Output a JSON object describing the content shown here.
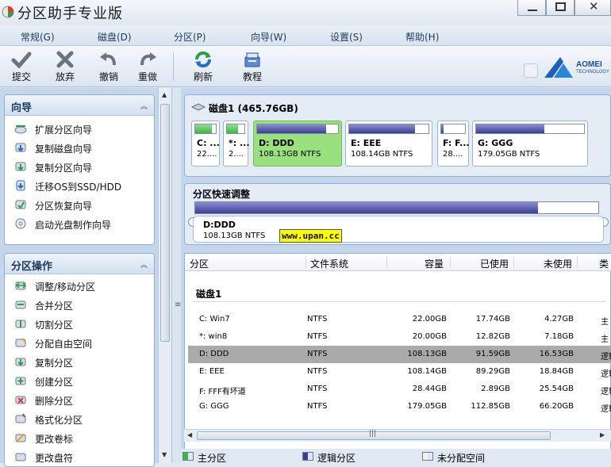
{
  "titlebar": {
    "title": "分区助手专业版"
  },
  "menu": [
    "常规(G)",
    "磁盘(D)",
    "分区(P)",
    "向导(W)",
    "设置(S)",
    "帮助(H)"
  ],
  "toolbar": {
    "buttons": [
      {
        "label": "提交",
        "icon": "check-icon"
      },
      {
        "label": "放弃",
        "icon": "discard-icon"
      },
      {
        "label": "撤销",
        "icon": "undo-icon"
      },
      {
        "label": "重做",
        "icon": "redo-icon"
      },
      {
        "label": "刷新",
        "icon": "refresh-icon"
      },
      {
        "label": "教程",
        "icon": "tutorial-icon"
      }
    ],
    "logo_line1": "AOMEI",
    "logo_line2": "TECHNOLOGY"
  },
  "wizard_panel": {
    "title": "向导",
    "items": [
      "扩展分区向导",
      "复制磁盘向导",
      "复制分区向导",
      "迁移OS到SSD/HDD",
      "分区恢复向导",
      "启动光盘制作向导"
    ]
  },
  "ops_panel": {
    "title": "分区操作",
    "items": [
      "调整/移动分区",
      "合并分区",
      "切割分区",
      "分配自由空间",
      "复制分区",
      "创建分区",
      "删除分区",
      "格式化分区",
      "更改卷标",
      "更改盘符"
    ]
  },
  "disk": {
    "title": "磁盘1 (465.76GB)",
    "partitions": [
      {
        "name": "C: ...",
        "size": "22....",
        "used_fraction": 0.81,
        "color": "#3cb54a",
        "selected": false
      },
      {
        "name": "*: ...",
        "size": "2....",
        "used_fraction": 0.64,
        "color": "#3cb54a",
        "selected": false
      },
      {
        "name": "D: DDD",
        "size": "108.13GB NTFS",
        "used_fraction": 0.85,
        "color": "#3b3e95",
        "selected": true
      },
      {
        "name": "E: EEE",
        "size": "108.14GB NTFS",
        "used_fraction": 0.83,
        "color": "#3b3e95",
        "selected": false
      },
      {
        "name": "F: F...",
        "size": "28....",
        "used_fraction": 0.1,
        "color": "#3b3e95",
        "selected": false
      },
      {
        "name": "G: GGG",
        "size": "179.05GB NTFS",
        "used_fraction": 0.63,
        "color": "#3b3e95",
        "selected": false
      }
    ]
  },
  "quick": {
    "title": "分区快速调整",
    "name": "D:DDD",
    "size": "108.13GB NTFS",
    "fill_fraction": 0.85,
    "watermark": "www.upan.cc"
  },
  "table": {
    "headers": [
      "分区",
      "文件系统",
      "容量",
      "已使用",
      "未使用",
      "类"
    ],
    "group": "磁盘1",
    "rows": [
      {
        "partition": "C: Win7",
        "fs": "NTFS",
        "capacity": "22.00GB",
        "used": "17.74GB",
        "free": "4.27GB",
        "type": "主",
        "selected": false
      },
      {
        "partition": "*: win8",
        "fs": "NTFS",
        "capacity": "20.00GB",
        "used": "12.82GB",
        "free": "7.18GB",
        "type": "主",
        "selected": false
      },
      {
        "partition": "D: DDD",
        "fs": "NTFS",
        "capacity": "108.13GB",
        "used": "91.59GB",
        "free": "16.53GB",
        "type": "逻辑",
        "selected": true
      },
      {
        "partition": "E: EEE",
        "fs": "NTFS",
        "capacity": "108.14GB",
        "used": "89.29GB",
        "free": "18.84GB",
        "type": "逻辑",
        "selected": false
      },
      {
        "partition": "F: FFF有坏道",
        "fs": "NTFS",
        "capacity": "28.44GB",
        "used": "2.89GB",
        "free": "25.54GB",
        "type": "逻辑",
        "selected": false
      },
      {
        "partition": "G: GGG",
        "fs": "NTFS",
        "capacity": "179.05GB",
        "used": "112.85GB",
        "free": "66.20GB",
        "type": "逻辑",
        "selected": false
      }
    ]
  },
  "legend": [
    {
      "label": "主分区",
      "color": "#3cb54a"
    },
    {
      "label": "逻辑分区",
      "color": "#3b3e95"
    },
    {
      "label": "未分配空间",
      "color": "#f2f2ea"
    }
  ]
}
